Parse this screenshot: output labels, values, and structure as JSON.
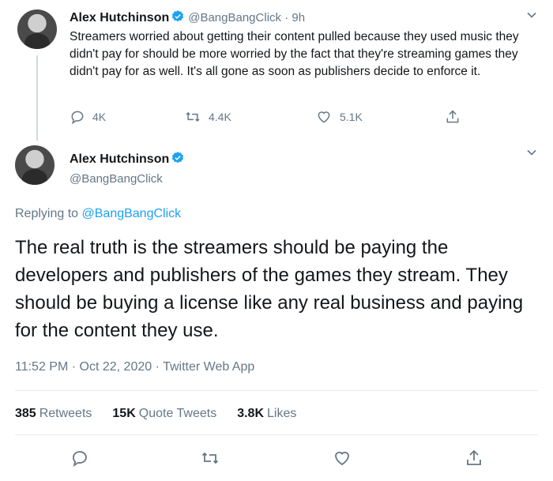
{
  "tweet1": {
    "name": "Alex Hutchinson",
    "handle": "@BangBangClick",
    "time": "9h",
    "text": "Streamers worried about getting their content pulled because they used music they didn't pay for should be more worried by the fact that they're streaming games they didn't pay for as well. It's all gone as soon as publishers decide to enforce it.",
    "replies": "4K",
    "retweets": "4.4K",
    "likes": "5.1K"
  },
  "tweet2": {
    "name": "Alex Hutchinson",
    "handle": "@BangBangClick",
    "replying_prefix": "Replying to",
    "replying_to": "@BangBangClick",
    "text": "The real truth is the streamers should be paying the developers and publishers of the games they stream. They should be buying a license like any real business and paying for the content they use.",
    "timestamp": "11:52 PM · Oct 22, 2020 · Twitter Web App",
    "retweets_count": "385",
    "retweets_label": "Retweets",
    "quotes_count": "15K",
    "quotes_label": "Quote Tweets",
    "likes_count": "3.8K",
    "likes_label": "Likes"
  },
  "colors": {
    "accent": "#1da1f2",
    "muted": "#657786",
    "text": "#14171a"
  },
  "icons": [
    "verified-icon",
    "chevron-down-icon",
    "reply-icon",
    "retweet-icon",
    "like-icon",
    "share-icon"
  ]
}
